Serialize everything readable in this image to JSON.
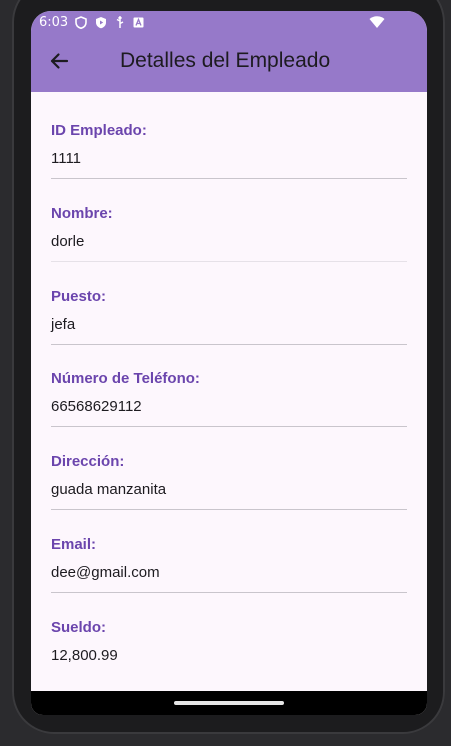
{
  "status_bar": {
    "time": "6:03",
    "icons": [
      "shield-icon",
      "play-protect-icon",
      "usb-icon",
      "a-badge-icon"
    ],
    "wifi_icon": "wifi-icon"
  },
  "app_bar": {
    "back_icon": "arrow-back-icon",
    "title": "Detalles del Empleado",
    "color": "#9679c9"
  },
  "employee": {
    "fields": [
      {
        "label": "ID Empleado:",
        "value": "1111"
      },
      {
        "label": "Nombre:",
        "value": "dorle"
      },
      {
        "label": "Puesto:",
        "value": "jefa"
      },
      {
        "label": "Número de Teléfono:",
        "value": "66568629112"
      },
      {
        "label": "Dirección:",
        "value": "guada manzanita"
      },
      {
        "label": "Email:",
        "value": "dee@gmail.com"
      },
      {
        "label": "Sueldo:",
        "value": "12,800.99"
      }
    ]
  },
  "colors": {
    "label": "#6b45ad",
    "background": "#fdf7fd"
  }
}
